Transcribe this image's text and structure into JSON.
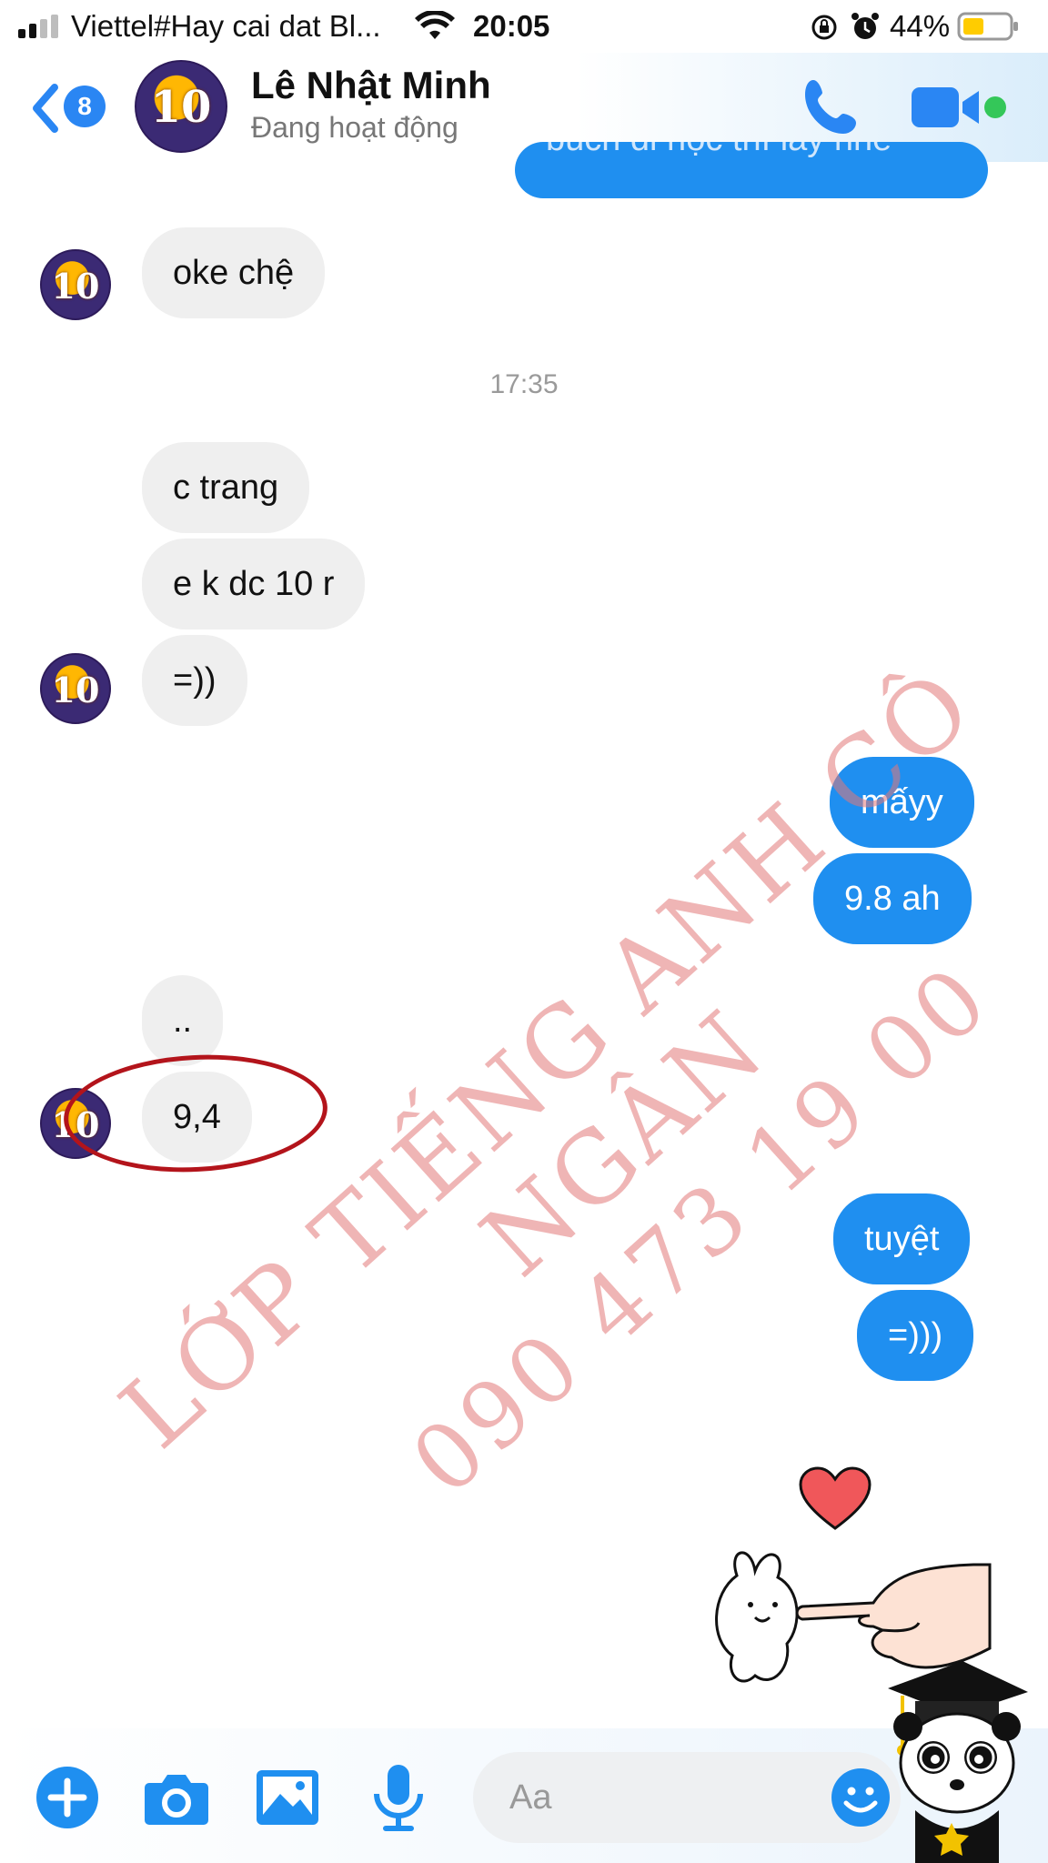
{
  "status_bar": {
    "carrier": "Viettel#Hay cai dat Bl...",
    "time": "20:05",
    "battery": "44%"
  },
  "header": {
    "back_badge": "8",
    "avatar_text": "10",
    "contact_name": "Lê Nhật Minh",
    "contact_status": "Đang hoạt động",
    "icons": {
      "back": "chevron-left-icon",
      "call": "phone-icon",
      "video": "video-camera-icon"
    }
  },
  "chat": {
    "partial_message": "bucri di học thì lấy nhé",
    "timestamp": "17:35",
    "messages": [
      {
        "from": "them",
        "text": "oke chệ"
      },
      {
        "from": "them",
        "text": "c trang"
      },
      {
        "from": "them",
        "text": "e k dc 10 r"
      },
      {
        "from": "them",
        "text": "=))"
      },
      {
        "from": "me",
        "text": "mấyy"
      },
      {
        "from": "me",
        "text": "9.8 ah"
      },
      {
        "from": "them",
        "text": ".."
      },
      {
        "from": "them",
        "text": "9,4"
      },
      {
        "from": "me",
        "text": "tuyệt"
      },
      {
        "from": "me",
        "text": "=)))"
      }
    ]
  },
  "watermark": {
    "line1": "LỚP TIẾNG ANH CÔ NGÂN",
    "line2": "090 473 19 00"
  },
  "composer": {
    "placeholder": "Aa",
    "value": ""
  },
  "toolbar": {
    "icons": [
      "plus-icon",
      "camera-icon",
      "image-icon",
      "microphone-icon",
      "emoji-icon"
    ]
  },
  "colors": {
    "accent": "#1f8ff0",
    "incoming_bubble": "#efefef",
    "annotation": "#b3141b",
    "watermark": "#e27878",
    "online": "#34c759"
  }
}
